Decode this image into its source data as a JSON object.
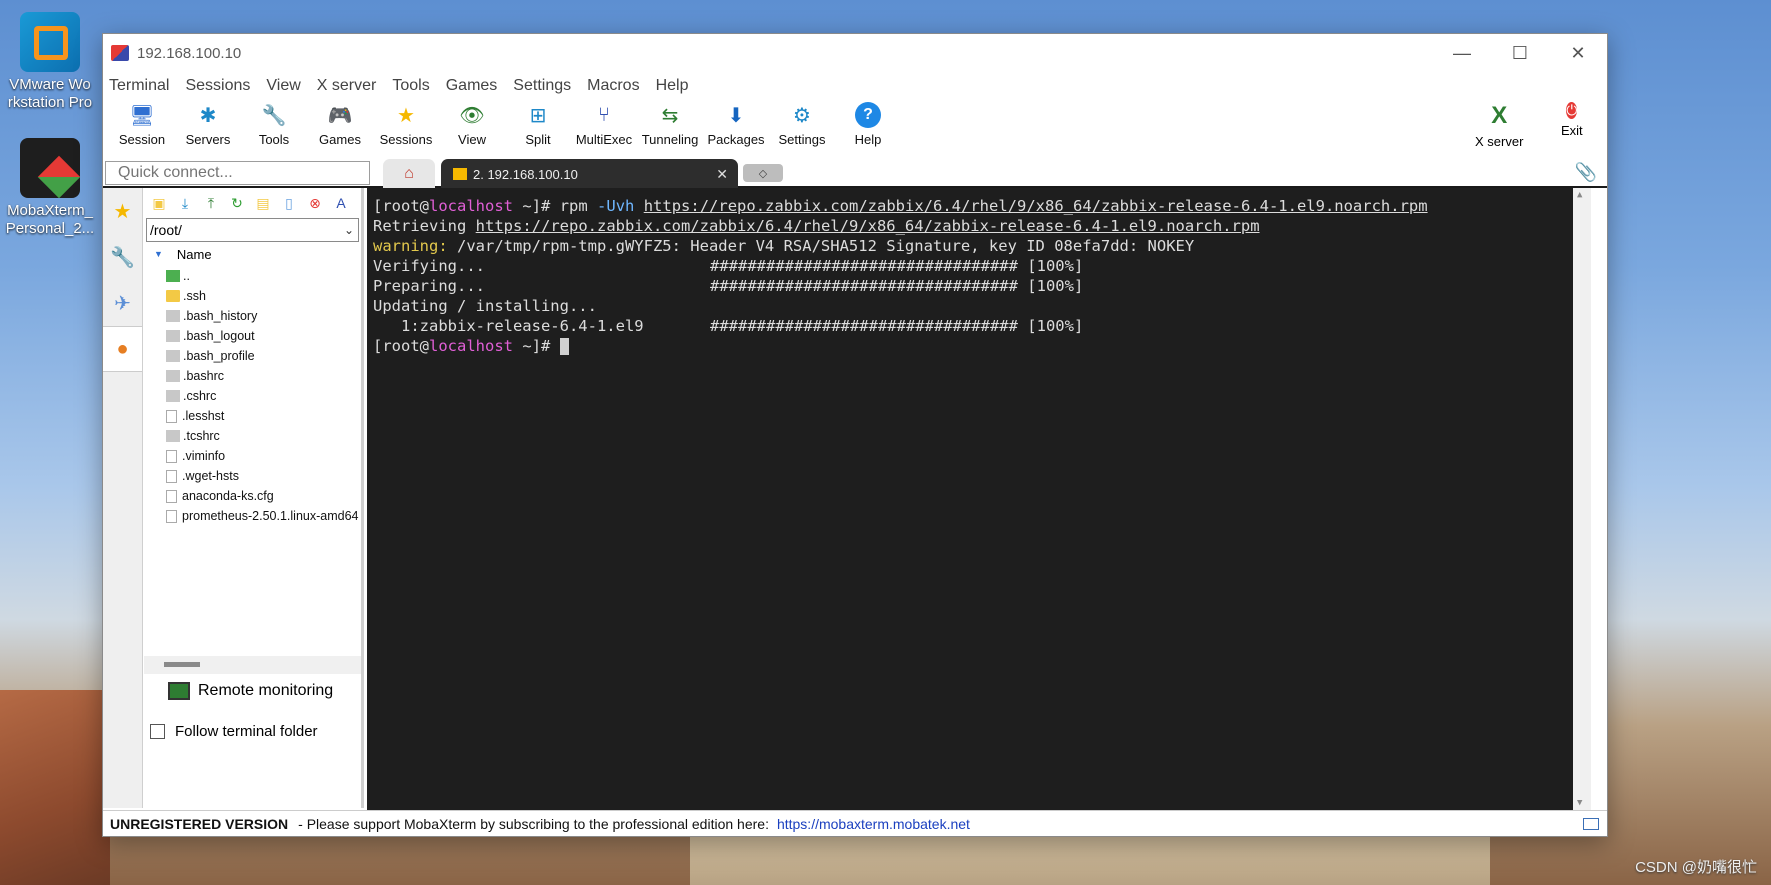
{
  "desktop": {
    "icons": [
      {
        "label_line1": "VMware Wo",
        "label_line2": "rkstation Pro"
      },
      {
        "label_line1": "MobaXterm_",
        "label_line2": "Personal_2..."
      }
    ],
    "watermark": "CSDN @奶嘴很忙"
  },
  "window": {
    "title": "192.168.100.10",
    "controls": {
      "minimize": "—",
      "maximize": "☐",
      "close": "✕"
    }
  },
  "menu": [
    "Terminal",
    "Sessions",
    "View",
    "X server",
    "Tools",
    "Games",
    "Settings",
    "Macros",
    "Help"
  ],
  "toolbar": {
    "items": [
      {
        "label": "Session",
        "icon": "session-icon",
        "glyph": "🖥"
      },
      {
        "label": "Servers",
        "icon": "servers-icon",
        "glyph": "✱"
      },
      {
        "label": "Tools",
        "icon": "tools-icon",
        "glyph": "🔧"
      },
      {
        "label": "Games",
        "icon": "games-icon",
        "glyph": "🎮"
      },
      {
        "label": "Sessions",
        "icon": "sessions-icon",
        "glyph": "★"
      },
      {
        "label": "View",
        "icon": "view-icon",
        "glyph": "👁"
      },
      {
        "label": "Split",
        "icon": "split-icon",
        "glyph": "⊞"
      },
      {
        "label": "MultiExec",
        "icon": "multiexec-icon",
        "glyph": "⑂"
      },
      {
        "label": "Tunneling",
        "icon": "tunneling-icon",
        "glyph": "⇆"
      },
      {
        "label": "Packages",
        "icon": "packages-icon",
        "glyph": "⬇"
      },
      {
        "label": "Settings",
        "icon": "settings-icon",
        "glyph": "⚙"
      },
      {
        "label": "Help",
        "icon": "help-icon",
        "glyph": "?"
      }
    ],
    "xserver_label": "X server",
    "exit_label": "Exit"
  },
  "quick_connect": {
    "placeholder": "Quick connect..."
  },
  "tabs": {
    "active_label": "2. 192.168.100.10",
    "close_glyph": "✕",
    "new_glyph": "◇"
  },
  "file_browser": {
    "path": "/root/",
    "column_header": "Name",
    "files": [
      {
        "name": "..",
        "type": "up"
      },
      {
        "name": ".ssh",
        "type": "folder"
      },
      {
        "name": ".bash_history",
        "type": "hidden"
      },
      {
        "name": ".bash_logout",
        "type": "hidden"
      },
      {
        "name": ".bash_profile",
        "type": "hidden"
      },
      {
        "name": ".bashrc",
        "type": "hidden"
      },
      {
        "name": ".cshrc",
        "type": "hidden"
      },
      {
        "name": ".lesshst",
        "type": "doc"
      },
      {
        "name": ".tcshrc",
        "type": "hidden"
      },
      {
        "name": ".viminfo",
        "type": "doc"
      },
      {
        "name": ".wget-hsts",
        "type": "doc"
      },
      {
        "name": "anaconda-ks.cfg",
        "type": "doc"
      },
      {
        "name": "prometheus-2.50.1.linux-amd64",
        "type": "doc"
      }
    ],
    "remote_monitoring_label": "Remote monitoring",
    "follow_terminal_label": "Follow terminal folder"
  },
  "terminal": {
    "prompt_user": "root",
    "prompt_host": "localhost",
    "prompt_dir": "~",
    "cmd_name": "rpm",
    "cmd_flag": "-Uvh",
    "url": "https://repo.zabbix.com/zabbix/6.4/rhel/9/x86_64/zabbix-release-6.4-1.el9.noarch.rpm",
    "retrieving_label": "Retrieving",
    "warning_label": "warning:",
    "warning_text": " /var/tmp/rpm-tmp.gWYFZ5: Header V4 RSA/SHA512 Signature, key ID 08efa7dd: NOKEY",
    "progress_lines": [
      {
        "label": "Verifying...",
        "bar": "################################# [100%]"
      },
      {
        "label": "Preparing...",
        "bar": "################################# [100%]"
      }
    ],
    "updating_label": "Updating / installing...",
    "package_line": {
      "label": "   1:zabbix-release-6.4-1.el9",
      "bar": "################################# [100%]"
    }
  },
  "statusbar": {
    "unregistered": "UNREGISTERED VERSION",
    "message": "-  Please support MobaXterm by subscribing to the professional edition here:",
    "link": "https://mobaxterm.mobatek.net"
  }
}
